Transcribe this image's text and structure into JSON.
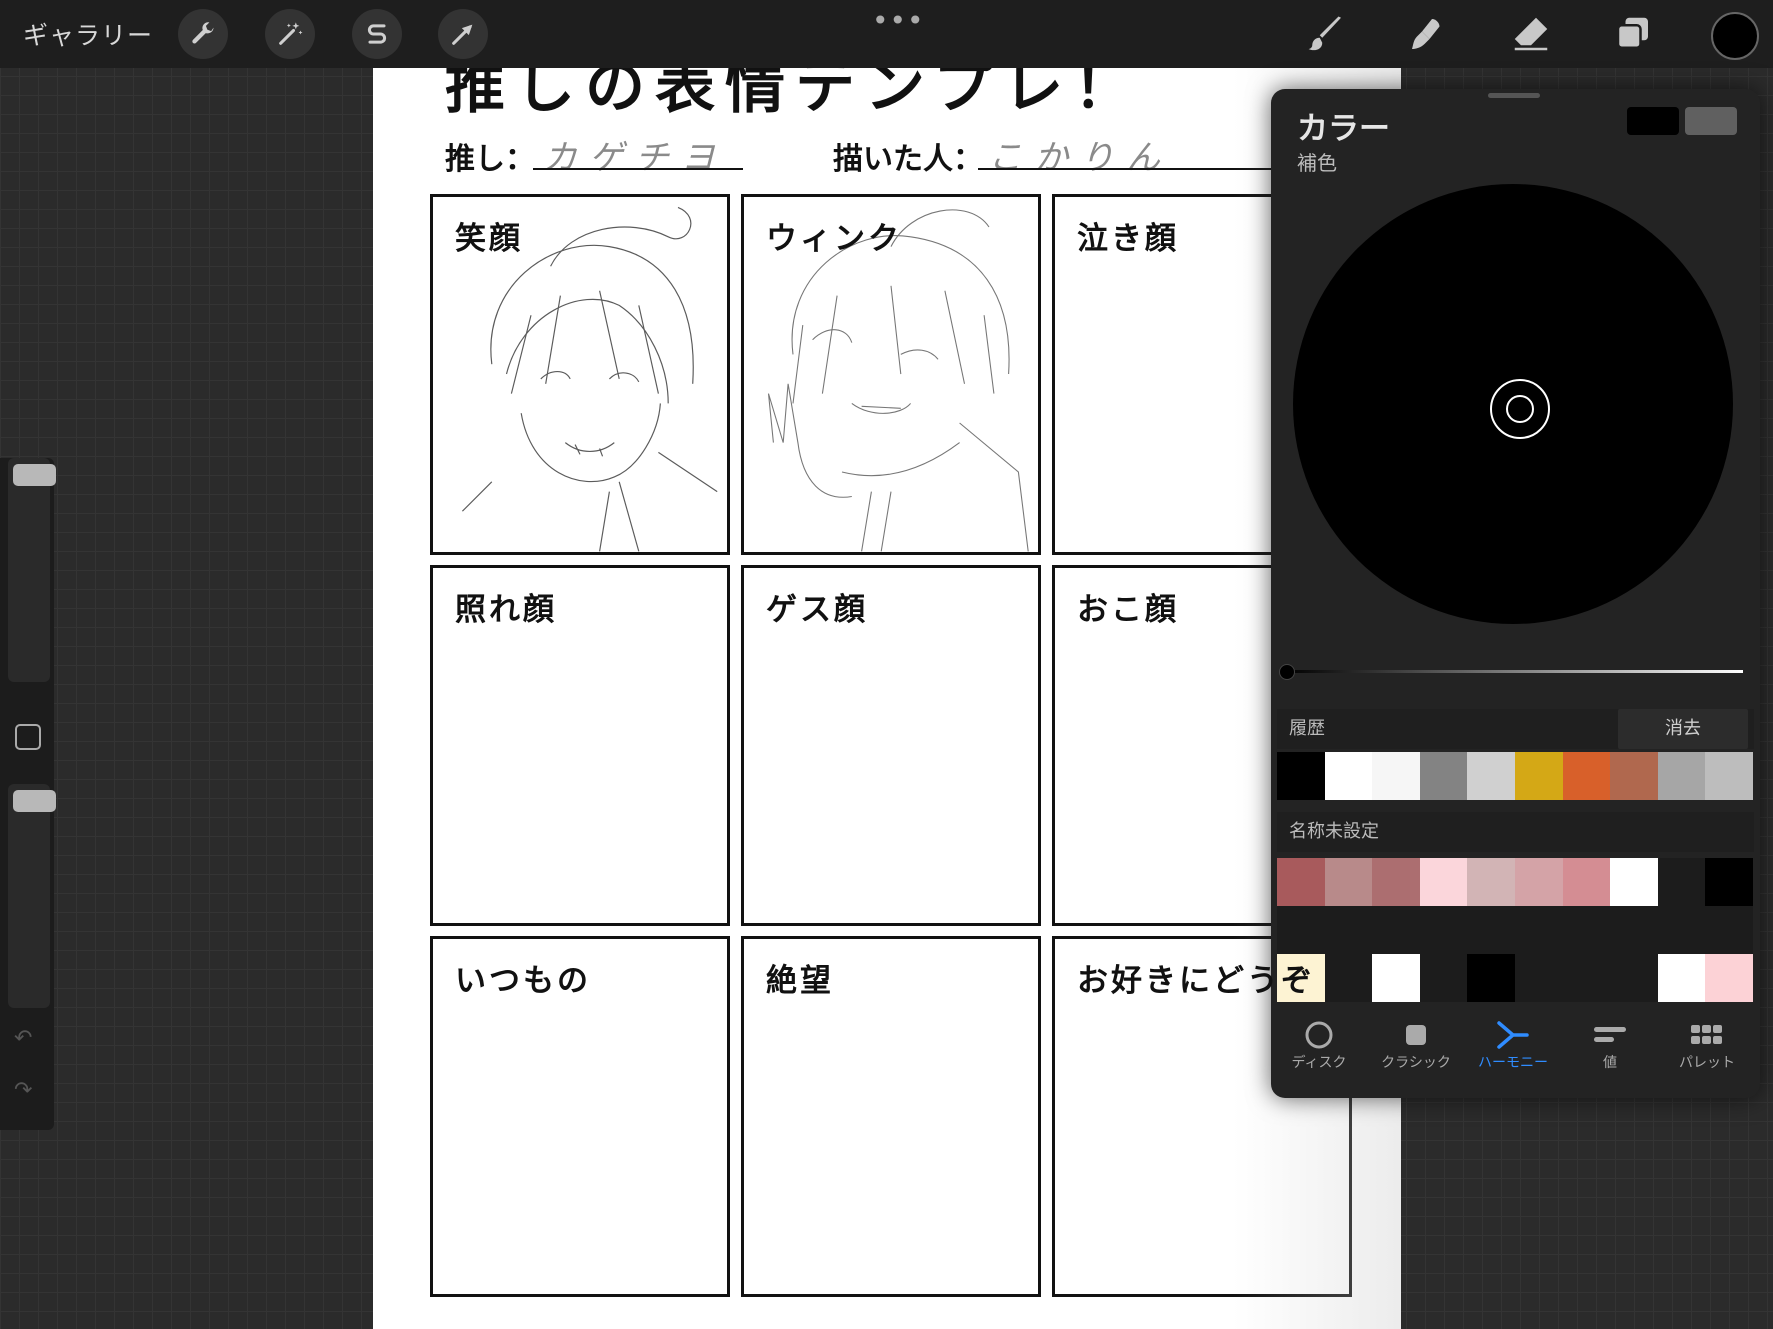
{
  "toolbar": {
    "gallery_label": "ギャラリー",
    "more_label": "•••"
  },
  "document": {
    "title_fragment": "推しの表情テンプレ！",
    "oshi_label": "推し：",
    "oshi_value": "カゲチヨ",
    "artist_label": "描いた人：",
    "artist_value": "こかりん",
    "cells": [
      "笑顔",
      "ウィンク",
      "泣き顔",
      "照れ顔",
      "ゲス顔",
      "おこ顔",
      "いつもの",
      "絶望",
      "お好きにどうぞ"
    ]
  },
  "color_panel": {
    "title": "カラー",
    "mode": "補色",
    "primary_color": "#000000",
    "secondary_color": "#606060",
    "history_label": "履歴",
    "clear_label": "消去",
    "history_swatches": [
      "#000000",
      "#ffffff",
      "#f6f6f6",
      "#838383",
      "#d0d0d0",
      "#d4a816",
      "#d8602a",
      "#b0684e",
      "#a6a6a6",
      "#bdbdbd"
    ],
    "palette_name": "名称未設定",
    "palette_row1": [
      "#a85a5c",
      "#b88a8a",
      "#ac6e70",
      "#fbd6db",
      "#d2b4b5",
      "#d4a3a7",
      "#d48d93",
      "#ffffff",
      "#1c1c1c",
      "#000000"
    ],
    "palette_row2": [
      "#1c1c1c",
      "#1c1c1c",
      "#1c1c1c",
      "#1c1c1c",
      "#1c1c1c",
      "#1c1c1c",
      "#1c1c1c",
      "#1c1c1c",
      "#1c1c1c",
      "#1c1c1c"
    ],
    "palette_row3": [
      "#fdf3d3",
      "#1c1c1c",
      "#ffffff",
      "#1c1c1c",
      "#000000",
      "#1c1c1c",
      "#1c1c1c",
      "#1c1c1c",
      "#ffffff",
      "#fcd2d6"
    ],
    "tabs": [
      {
        "label": "ディスク",
        "icon": "disc-icon"
      },
      {
        "label": "クラシック",
        "icon": "classic-square-icon"
      },
      {
        "label": "ハーモニー",
        "icon": "harmony-icon",
        "active": true
      },
      {
        "label": "値",
        "icon": "value-sliders-icon"
      },
      {
        "label": "パレット",
        "icon": "palette-grid-icon"
      }
    ]
  }
}
